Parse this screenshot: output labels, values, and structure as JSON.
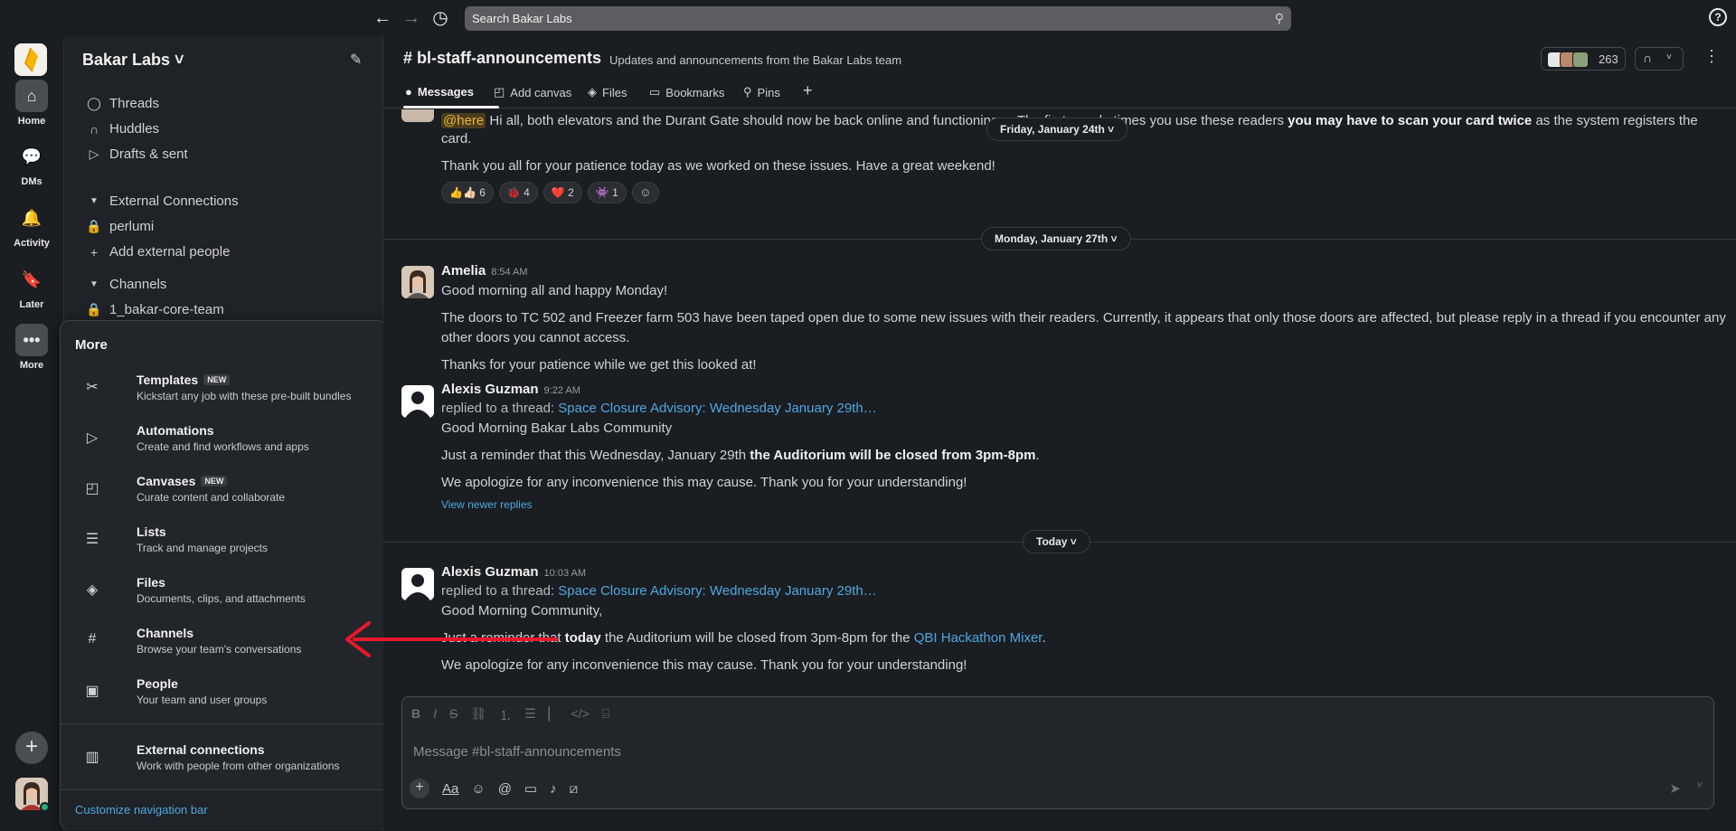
{
  "topbar": {
    "search_placeholder": "Search Bakar Labs",
    "back": "←",
    "forward": "→",
    "history": "◷",
    "help": "?"
  },
  "rail": {
    "home": "Home",
    "dms": "DMs",
    "activity": "Activity",
    "later": "Later",
    "more": "More"
  },
  "sidebar": {
    "workspace": "Bakar Labs ˅",
    "threads": "Threads",
    "huddles": "Huddles",
    "drafts": "Drafts & sent",
    "external_section": "External Connections",
    "perlumi": "perlumi",
    "add_external": "Add external people",
    "channels_section": "Channels",
    "channel1": "1_bakar-core-team"
  },
  "more_panel": {
    "title": "More",
    "items": [
      {
        "title": "Templates",
        "badge": "NEW",
        "desc": "Kickstart any job with these pre-built bundles"
      },
      {
        "title": "Automations",
        "badge": "",
        "desc": "Create and find workflows and apps"
      },
      {
        "title": "Canvases",
        "badge": "NEW",
        "desc": "Curate content and collaborate"
      },
      {
        "title": "Lists",
        "badge": "",
        "desc": "Track and manage projects"
      },
      {
        "title": "Files",
        "badge": "",
        "desc": "Documents, clips, and attachments"
      },
      {
        "title": "Channels",
        "badge": "",
        "desc": "Browse your team's conversations"
      },
      {
        "title": "People",
        "badge": "",
        "desc": "Your team and user groups"
      },
      {
        "title": "External connections",
        "badge": "",
        "desc": "Work with people from other organizations"
      }
    ],
    "customize": "Customize navigation bar"
  },
  "channel": {
    "name": "# bl-staff-announcements",
    "description": "Updates and announcements from the Bakar Labs team",
    "member_count": "263",
    "tabs": [
      "Messages",
      "Add canvas",
      "Files",
      "Bookmarks",
      "Pins"
    ]
  },
  "messages": {
    "m0_mention": "@here",
    "m0_line1a": " Hi all, both elevators and the Durant Gate should now be back online and functioning ",
    "m0_line1b": "... The first couple times you use these readers ",
    "m0_bold": "you may have to scan your card twice",
    "m0_line1c": " as the system registers the",
    "m0_line2": "card.",
    "m0_line3": "Thank you all for your patience today as we worked on these issues. Have a great weekend!",
    "reactions": [
      "👍👍🏻 6",
      "🐞 4",
      "❤️ 2",
      "👾 1"
    ],
    "date1": "Friday, January 24th ˅",
    "date2": "Monday, January 27th ˅",
    "date3": "Today ˅",
    "amelia_name": "Amelia",
    "amelia_time": "8:54 AM",
    "amelia_l1": "Good morning all and happy Monday!",
    "amelia_l2": "The doors to TC 502 and Freezer farm 503 have been taped open due to some new issues with their readers. Currently, it appears that only those doors are affected, but please reply in a thread if you encounter any",
    "amelia_l3": "other doors you cannot access.",
    "amelia_l4": "Thanks for your patience while we get this looked at!",
    "ag1_name": "Alexis Guzman",
    "ag1_time": "9:22 AM",
    "ag1_replied": "replied to a thread: ",
    "ag1_thread": "Space Closure Advisory: Wednesday January 29th…",
    "ag1_l1": "Good Morning Bakar Labs Community",
    "ag1_l2a": "Just a reminder that this Wednesday, January 29th ",
    "ag1_l2b": "the Auditorium will be closed from 3pm-8pm",
    "ag1_l2c": ".",
    "ag1_l3": "We apologize for any inconvenience this may cause. Thank you for your understanding!",
    "ag1_newer": "View newer replies",
    "ag2_name": "Alexis Guzman",
    "ag2_time": "10:03 AM",
    "ag2_replied": "replied to a thread: ",
    "ag2_thread": "Space Closure Advisory: Wednesday January 29th…",
    "ag2_l1": "Good Morning Community,",
    "ag2_l2a": "Just a reminder that ",
    "ag2_l2b": "today",
    "ag2_l2c": " the Auditorium will be closed from 3pm-8pm for the ",
    "ag2_l2link": "QBI Hackathon Mixer",
    "ag2_l2d": ".",
    "ag2_l3": "We apologize for any inconvenience this may cause. Thank you for your understanding!"
  },
  "composer": {
    "placeholder": "Message #bl-staff-announcements"
  },
  "colors": {
    "accent_link": "#4fa8e0",
    "annotation_arrow": "#e8192c",
    "mention_bg": "#4a3d1c"
  }
}
